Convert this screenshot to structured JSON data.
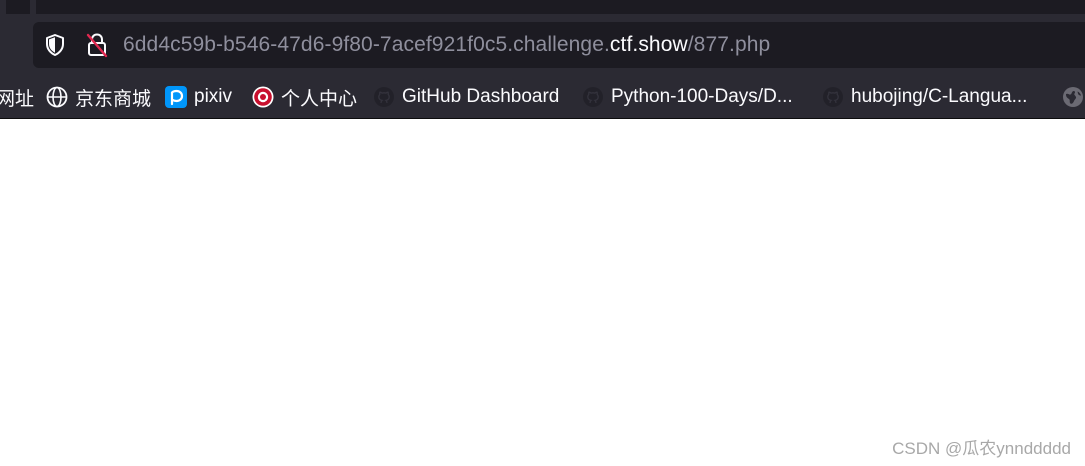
{
  "nav": {
    "url_prefix": "6dd4c59b-b546-47d6-9f80-7acef921f0c5.challenge.",
    "url_domain": "ctf.show",
    "url_path": "/877.php"
  },
  "bookmarks": [
    {
      "label": "网址",
      "icon": "none"
    },
    {
      "label": "京东商城",
      "icon": "globe-icon"
    },
    {
      "label": "pixiv",
      "icon": "pixiv-icon"
    },
    {
      "label": "个人中心",
      "icon": "badge-icon"
    },
    {
      "label": "GitHub Dashboard",
      "icon": "github-icon"
    },
    {
      "label": "Python-100-Days/D...",
      "icon": "github-icon"
    },
    {
      "label": "hubojing/C-Langua...",
      "icon": "github-icon"
    },
    {
      "label": "",
      "icon": "globe-icon"
    }
  ],
  "watermark": "CSDN @瓜农ynnddddd",
  "colors": {
    "toolbar": "#2b2a33",
    "url_field": "#1c1b22",
    "text": "#fbfbfe",
    "muted_text": "#8f8f9d",
    "pixiv_blue": "#0096fa",
    "badge_red": "#c8102e"
  }
}
